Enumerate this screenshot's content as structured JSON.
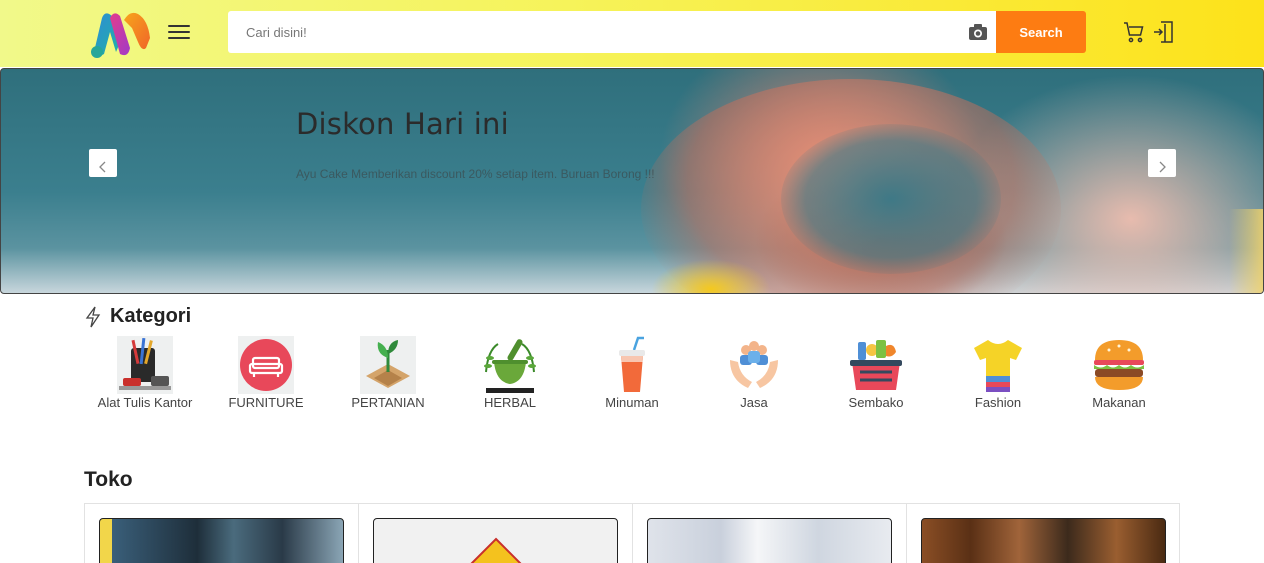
{
  "header": {
    "search_placeholder": "Cari disini!",
    "search_button": "Search",
    "colors": {
      "accent": "#fd7c12",
      "header_start": "#f1f98a",
      "header_end": "#fde21a"
    }
  },
  "banner": {
    "title": "Diskon Hari ini",
    "subtitle": "Ayu Cake Memberikan discount 20% setiap item. Buruan Borong !!!"
  },
  "kategori": {
    "title": "Kategori",
    "items": [
      {
        "label": "Alat Tulis Kantor",
        "icon": "stationery-icon"
      },
      {
        "label": "FURNITURE",
        "icon": "sofa-icon"
      },
      {
        "label": "PERTANIAN",
        "icon": "plant-icon"
      },
      {
        "label": "HERBAL",
        "icon": "mortar-pestle-icon"
      },
      {
        "label": "Minuman",
        "icon": "drink-cup-icon"
      },
      {
        "label": "Jasa",
        "icon": "service-hands-icon"
      },
      {
        "label": "Sembako",
        "icon": "grocery-basket-icon"
      },
      {
        "label": "Fashion",
        "icon": "tshirt-icon"
      },
      {
        "label": "Makanan",
        "icon": "burger-icon"
      }
    ]
  },
  "toko": {
    "title": "Toko"
  }
}
